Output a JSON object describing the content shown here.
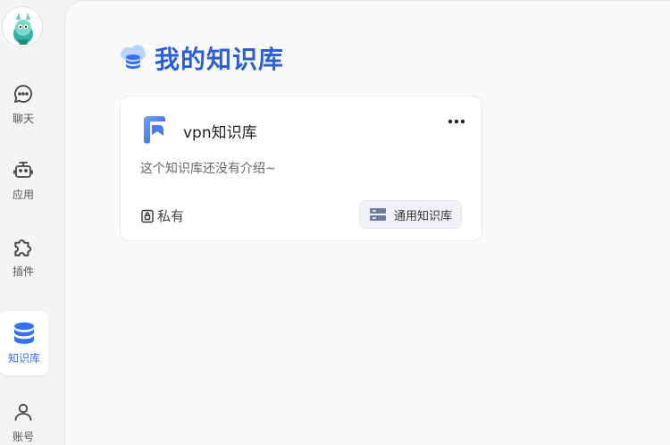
{
  "sidebar": {
    "items": [
      {
        "label": "聊天",
        "icon": "chat-icon"
      },
      {
        "label": "应用",
        "icon": "robot-icon"
      },
      {
        "label": "插件",
        "icon": "puzzle-icon"
      },
      {
        "label": "知识库",
        "icon": "database-icon",
        "active": true
      },
      {
        "label": "账号",
        "icon": "user-icon"
      }
    ]
  },
  "main": {
    "title": "我的知识库",
    "cards": [
      {
        "name": "vpn知识库",
        "description": "这个知识库还没有介绍~",
        "privacy": "私有",
        "type": "通用知识库"
      }
    ]
  },
  "colors": {
    "accent": "#3370ff",
    "title": "#2b5fd9"
  }
}
